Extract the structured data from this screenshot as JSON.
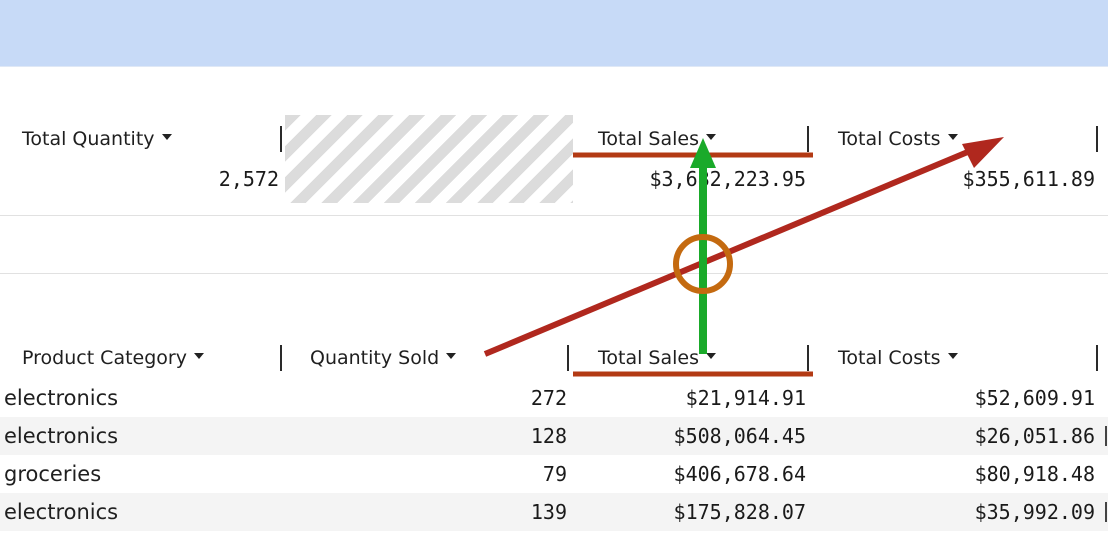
{
  "summary": {
    "headers": {
      "total_quantity": "Total Quantity",
      "total_sales": "Total Sales",
      "total_costs": "Total Costs"
    },
    "values": {
      "total_quantity": "2,572",
      "total_sales": "$3,682,223.95",
      "total_costs": "$355,611.89"
    }
  },
  "table": {
    "headers": {
      "product_category": "Product Category",
      "quantity_sold": "Quantity Sold",
      "total_sales": "Total Sales",
      "total_costs": "Total Costs"
    },
    "rows": [
      {
        "category": "electronics",
        "quantity": "272",
        "sales": "$21,914.91",
        "costs": "$52,609.91"
      },
      {
        "category": "electronics",
        "quantity": "128",
        "sales": "$508,064.45",
        "costs": "$26,051.86"
      },
      {
        "category": "groceries",
        "quantity": "79",
        "sales": "$406,678.64",
        "costs": "$80,918.48"
      },
      {
        "category": "electronics",
        "quantity": "139",
        "sales": "$175,828.07",
        "costs": "$35,992.09"
      }
    ]
  },
  "colors": {
    "header_band": "#c7daf7",
    "arrow_red": "#b0281e",
    "arrow_green": "#1aaa2a",
    "circle_orange": "#c46a10",
    "underline_red": "#b33a14"
  }
}
